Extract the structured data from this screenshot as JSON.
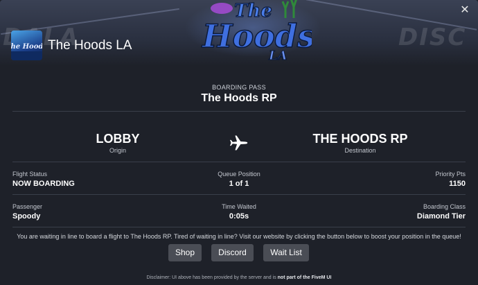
{
  "banner": {
    "ghost_left": "DALA",
    "ghost_right": "DISC",
    "logo_text_1": "The",
    "logo_text_2": "Hoods",
    "logo_text_3": "LA"
  },
  "server": {
    "name": "The Hoods LA",
    "icon_text": "The Hoods"
  },
  "close_icon": "close-icon",
  "pass": {
    "label": "BOARDING PASS",
    "title": "The Hoods RP",
    "origin_code": "LOBBY",
    "origin_label": "Origin",
    "destination_code": "THE HOODS RP",
    "destination_label": "Destination",
    "plane_icon": "airplane-icon"
  },
  "fields": {
    "flight_status_label": "Flight Status",
    "flight_status_value": "NOW BOARDING",
    "queue_position_label": "Queue Position",
    "queue_position_value": "1 of 1",
    "priority_label": "Priority Pts",
    "priority_value": "1150",
    "passenger_label": "Passenger",
    "passenger_value": "Spoody",
    "time_waited_label": "Time Waited",
    "time_waited_value": "0:05s",
    "boarding_class_label": "Boarding Class",
    "boarding_class_value": "Diamond Tier"
  },
  "notice": "You are waiting in line to board a flight to The Hoods RP. Tired of waiting in line? Visit our website by clicking the button below to boost your position in the queue!",
  "buttons": {
    "shop": "Shop",
    "discord": "Discord",
    "wait_list": "Wait List"
  },
  "disclaimer": {
    "prefix": "Disclaimer: UI above has been provided by the server and is ",
    "emphasis": "not part of the FiveM UI"
  },
  "colors": {
    "background": "#1e2129",
    "button": "#4a4d55",
    "divider": "#3a3f4a",
    "logo_blue": "#3f6fe0",
    "logo_purple": "#a64bd6"
  }
}
